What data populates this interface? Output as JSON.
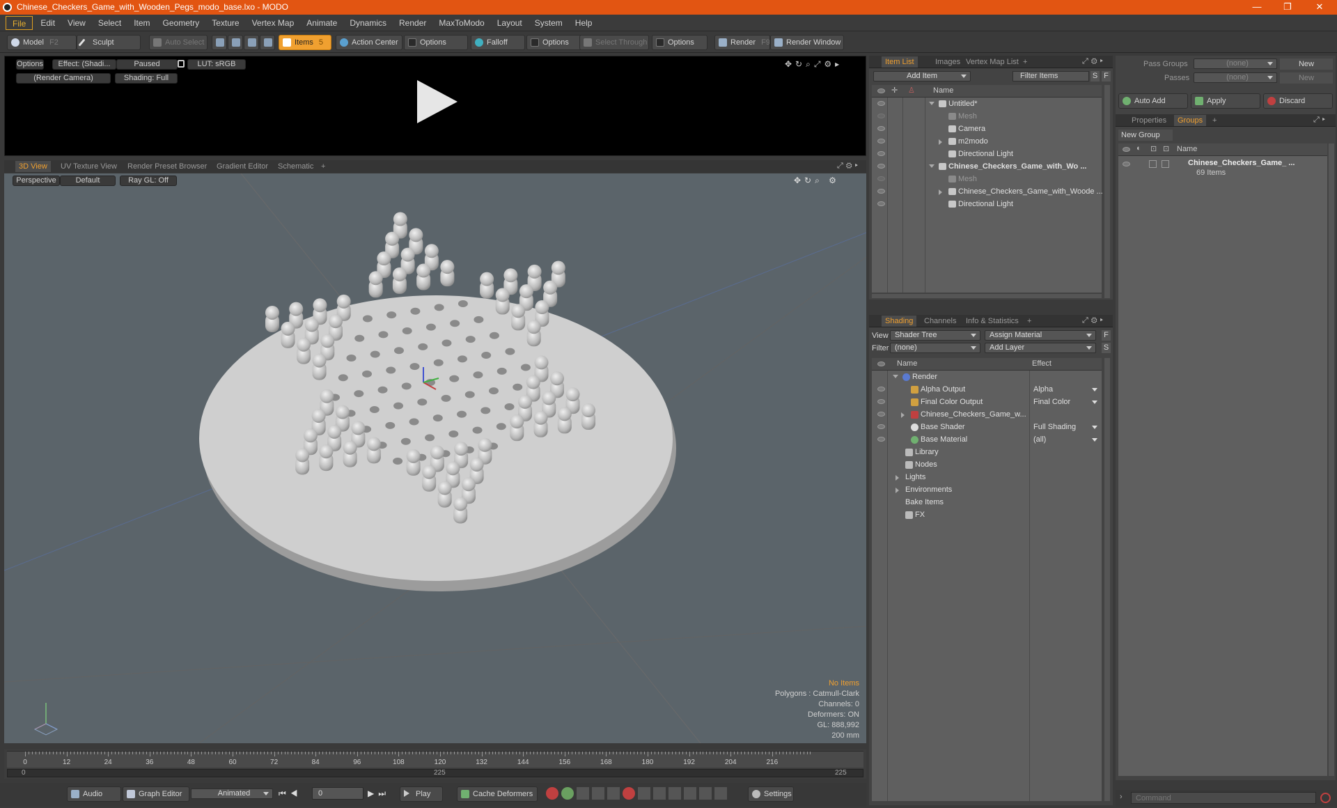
{
  "window": {
    "title": "Chinese_Checkers_Game_with_Wooden_Pegs_modo_base.lxo - MODO",
    "minimize": "—",
    "restore": "❐",
    "close": "✕"
  },
  "menu": [
    "File",
    "Edit",
    "View",
    "Select",
    "Item",
    "Geometry",
    "Texture",
    "Vertex Map",
    "Animate",
    "Dynamics",
    "Render",
    "MaxToModo",
    "Layout",
    "System",
    "Help"
  ],
  "toolbar": {
    "model": "Model",
    "model_key": "F2",
    "sculpt": "Sculpt",
    "auto_select": "Auto Select",
    "items": "Items",
    "items_key": "5",
    "action_center": "Action Center",
    "options1": "Options",
    "falloff": "Falloff",
    "options2": "Options",
    "select_through": "Select Through",
    "options3": "Options",
    "render": "Render",
    "render_key": "F9",
    "render_window": "Render Window"
  },
  "preview": {
    "options": "Options",
    "effect": "Effect: (Shadi...",
    "paused": "Paused",
    "lut": "LUT: sRGB",
    "camera": "(Render Camera)",
    "shading": "Shading: Full"
  },
  "viewport_tabs": [
    "3D View",
    "UV Texture View",
    "Render Preset Browser",
    "Gradient Editor",
    "Schematic",
    "+"
  ],
  "viewport": {
    "perspective": "Perspective",
    "default": "Default",
    "raygl": "Ray GL: Off",
    "stats": {
      "no_items": "No Items",
      "polygons": "Polygons : Catmull-Clark",
      "channels": "Channels: 0",
      "deformers": "Deformers: ON",
      "gl": "GL: 888,992",
      "size": "200 mm"
    }
  },
  "timeline": {
    "ticks": [
      "0",
      "12",
      "24",
      "36",
      "48",
      "60",
      "72",
      "84",
      "96",
      "108",
      "120",
      "132",
      "144",
      "156",
      "168",
      "180",
      "192",
      "204",
      "216"
    ],
    "start": "0",
    "mid": "225",
    "end": "225"
  },
  "bottombar": {
    "audio": "Audio",
    "graph_editor": "Graph Editor",
    "animated": "Animated",
    "frame": "0",
    "play": "Play",
    "cache_deformers": "Cache Deformers",
    "settings": "Settings"
  },
  "item_list": {
    "tabs": [
      "Item List",
      "Images",
      "Vertex Map List",
      "+"
    ],
    "add_item": "Add Item",
    "filter_items": "Filter Items",
    "s": "S",
    "f": "F",
    "col_name": "Name",
    "rows": [
      {
        "label": "Untitled*",
        "indent": 0,
        "dim": false,
        "bold": false
      },
      {
        "label": "Mesh",
        "indent": 1,
        "dim": true,
        "bold": false
      },
      {
        "label": "Camera",
        "indent": 1,
        "dim": false,
        "bold": false
      },
      {
        "label": "m2modo",
        "indent": 1,
        "dim": false,
        "bold": false
      },
      {
        "label": "Directional Light",
        "indent": 1,
        "dim": false,
        "bold": false
      },
      {
        "label": "Chinese_Checkers_Game_with_Wo ...",
        "indent": 0,
        "dim": false,
        "bold": true
      },
      {
        "label": "Mesh",
        "indent": 1,
        "dim": true,
        "bold": false
      },
      {
        "label": "Chinese_Checkers_Game_with_Woode ...",
        "indent": 1,
        "dim": false,
        "bold": false
      },
      {
        "label": "Directional Light",
        "indent": 1,
        "dim": false,
        "bold": false
      }
    ]
  },
  "shading": {
    "tabs": [
      "Shading",
      "Channels",
      "Info & Statistics",
      "+"
    ],
    "view_label": "View",
    "view_value": "Shader Tree",
    "assign_material": "Assign Material",
    "f": "F",
    "filter_label": "Filter",
    "filter_value": "(none)",
    "add_layer": "Add Layer",
    "s": "S",
    "col_name": "Name",
    "col_effect": "Effect",
    "rows": [
      {
        "label": "Render",
        "effect": ""
      },
      {
        "label": "Alpha Output",
        "effect": "Alpha"
      },
      {
        "label": "Final Color Output",
        "effect": "Final Color"
      },
      {
        "label": "Chinese_Checkers_Game_w...",
        "effect": ""
      },
      {
        "label": "Base Shader",
        "effect": "Full Shading"
      },
      {
        "label": "Base Material",
        "effect": "(all)"
      },
      {
        "label": "Library",
        "effect": ""
      },
      {
        "label": "Nodes",
        "effect": ""
      },
      {
        "label": "Lights",
        "effect": ""
      },
      {
        "label": "Environments",
        "effect": ""
      },
      {
        "label": "Bake Items",
        "effect": ""
      },
      {
        "label": "FX",
        "effect": ""
      }
    ]
  },
  "right": {
    "pass_groups": "Pass Groups",
    "passes": "Passes",
    "none1": "(none)",
    "none2": "(none)",
    "new1": "New",
    "new2": "New",
    "auto_add": "Auto Add",
    "apply": "Apply",
    "discard": "Discard",
    "tabs": [
      "Properties",
      "Groups",
      "+"
    ],
    "new_group": "New Group",
    "col_name": "Name",
    "group_name": "Chinese_Checkers_Game_ ...",
    "group_count": "69 Items"
  },
  "command": {
    "placeholder": "Command"
  }
}
